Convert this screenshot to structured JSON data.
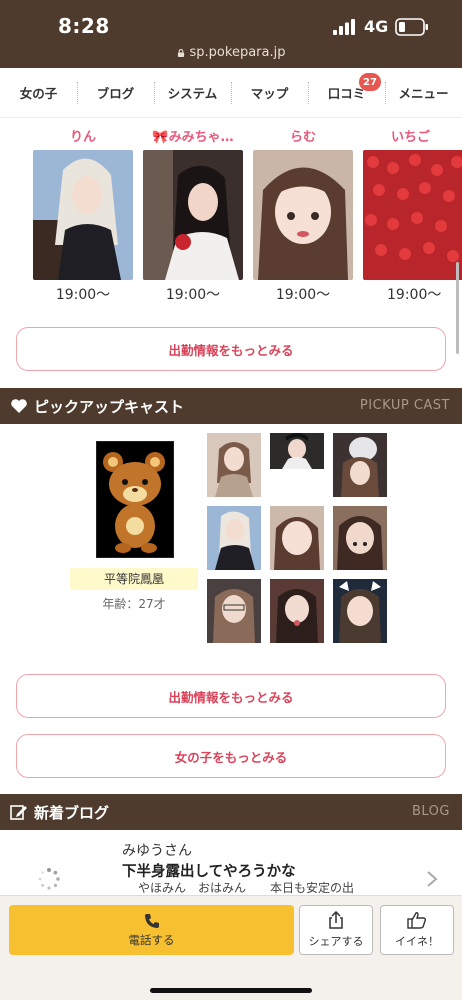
{
  "status": {
    "time": "8:28",
    "network": "4G",
    "url": "sp.pokepara.jp"
  },
  "nav": {
    "items": [
      {
        "label": "女の子"
      },
      {
        "label": "ブログ"
      },
      {
        "label": "システム"
      },
      {
        "label": "マップ"
      },
      {
        "label": "口コミ",
        "badge": "27"
      },
      {
        "label": "メニュー"
      }
    ]
  },
  "schedule": {
    "casts": [
      {
        "name": "りん",
        "time": "19:00〜"
      },
      {
        "name": "🎀みみちゃ…",
        "time": "19:00〜"
      },
      {
        "name": "らむ",
        "time": "19:00〜"
      },
      {
        "name": "いちご",
        "time": "19:00〜"
      }
    ],
    "more_label": "出勤情報をもっとみる"
  },
  "pickup": {
    "title": "ピックアップキャスト",
    "title_en": "PICKUP CAST",
    "main_name": "平等院鳳凰",
    "main_age": "年齢：27才",
    "more_schedule_label": "出勤情報をもっとみる",
    "more_girls_label": "女の子をもっとみる"
  },
  "blog": {
    "title": "新着ブログ",
    "title_en": "BLOG",
    "entry": {
      "user": "みゆうさん",
      "title": "下半身露出してやろうかな",
      "excerpt": "やほみん　おはみん　　本日も安定の出"
    }
  },
  "bottom": {
    "call_label": "電話する",
    "share_label": "シェアする",
    "like_label": "イイネ！"
  },
  "colors": {
    "brand_brown": "#4e3b2d",
    "accent_pink": "#d9445a",
    "call_yellow": "#f7c030"
  }
}
